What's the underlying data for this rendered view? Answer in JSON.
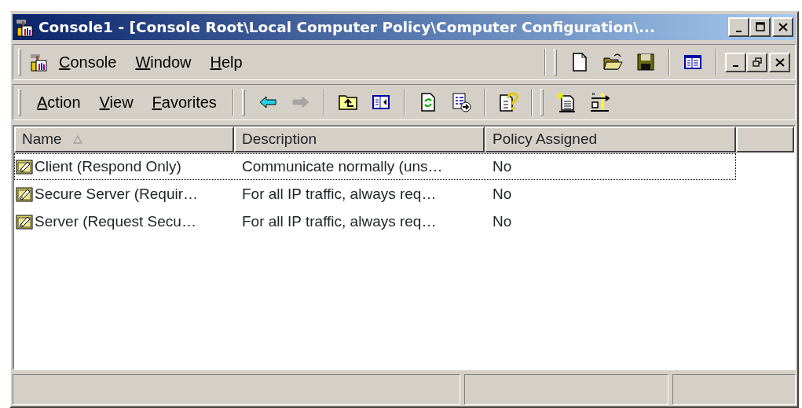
{
  "window": {
    "title": "Console1 - [Console Root\\Local Computer Policy\\Computer Configuration\\..."
  },
  "menu": [
    {
      "label": "Console"
    },
    {
      "label": "Window"
    },
    {
      "label": "Help"
    }
  ],
  "action_menu": [
    {
      "label": "Action"
    },
    {
      "label": "View"
    },
    {
      "label": "Favorites"
    }
  ],
  "toolbar": [
    {
      "kind": "back",
      "disabled": false
    },
    {
      "kind": "forward",
      "disabled": true
    },
    {
      "kind": "sep"
    },
    {
      "kind": "up",
      "disabled": false
    },
    {
      "kind": "tree",
      "disabled": false
    },
    {
      "kind": "sep"
    },
    {
      "kind": "refresh",
      "disabled": false
    },
    {
      "kind": "export",
      "disabled": false
    },
    {
      "kind": "sep"
    },
    {
      "kind": "help",
      "disabled": false
    },
    {
      "kind": "band"
    },
    {
      "kind": "newpolicy",
      "disabled": false
    },
    {
      "kind": "filters",
      "disabled": false
    }
  ],
  "table": {
    "columns": [
      {
        "label": "Name",
        "sorted": true
      },
      {
        "label": "Description",
        "sorted": false
      },
      {
        "label": "Policy Assigned",
        "sorted": false
      }
    ],
    "rows": [
      {
        "name": "Client (Respond Only)",
        "description": "Communicate normally (uns…",
        "policy_assigned": "No",
        "focused": true
      },
      {
        "name": "Secure Server (Requir…",
        "description": "For all IP traffic, always req…",
        "policy_assigned": "No",
        "focused": false
      },
      {
        "name": "Server (Request Secu…",
        "description": "For all IP traffic, always req…",
        "policy_assigned": "No",
        "focused": false
      }
    ]
  }
}
